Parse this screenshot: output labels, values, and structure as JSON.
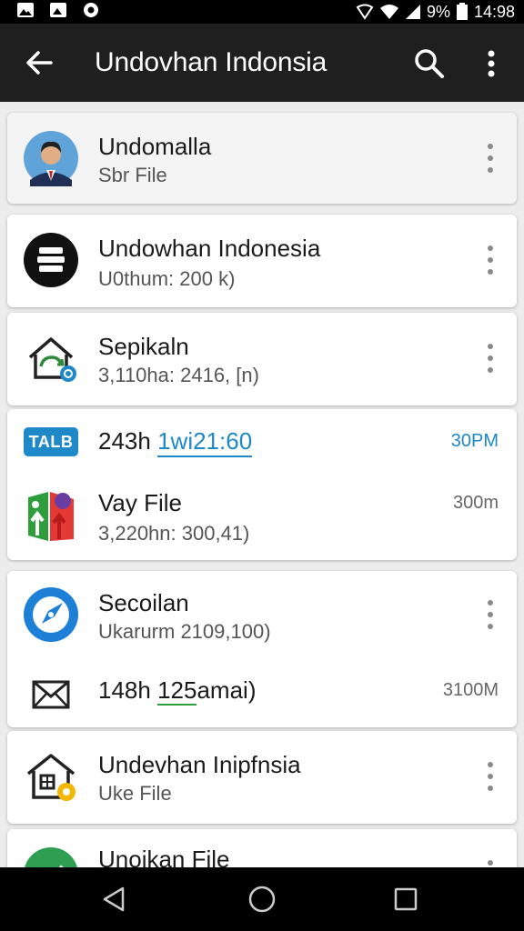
{
  "status_bar": {
    "battery": "9%",
    "time": "14:98",
    "icons": [
      "image-icon",
      "photo-icon",
      "settings-icon",
      "vpn-icon",
      "wifi-icon",
      "signal-icon",
      "battery-icon"
    ]
  },
  "app_bar": {
    "title": "Undovhan Indonsia",
    "icons": [
      "back-arrow-icon",
      "search-icon",
      "more-vert-icon"
    ]
  },
  "items": [
    {
      "icon": "avatar",
      "title": "Undomalla",
      "subtitle": "Sbr File"
    },
    {
      "icon": "archive-icon",
      "title": "Undowhan Indonesia",
      "subtitle": "U0thum: 200 k)"
    },
    {
      "icon": "home-sync-icon",
      "title": "Sepikaln",
      "subtitle": "3,110ha: 2416, [n)"
    },
    {
      "badge": "TALB",
      "title_prefix": "243h",
      "title_link": "1wi21:60",
      "time": "30PM",
      "sub_icon": "colorful-app-icon",
      "sub_title": "Vay File",
      "sub_subtitle": "3,220hn: 300,41)",
      "sub_time": "300m"
    },
    {
      "icon": "compass-icon",
      "title": "Secoilan",
      "subtitle": "Ukarurm 2109,100)",
      "sub_icon": "mail-icon",
      "sub_title_prefix": "148h ",
      "sub_title_hl": "125",
      "sub_title_rest": "amai)",
      "sub_time": "3100M"
    },
    {
      "icon": "home-badge-icon",
      "title": "Undevhan Inipfnsia",
      "subtitle": "Uke File"
    },
    {
      "icon": "green-app-icon",
      "title": "Unoikan File"
    }
  ],
  "nav_bar": {
    "icons": [
      "back-triangle-icon",
      "home-circle-icon",
      "recents-square-icon"
    ]
  },
  "colors": {
    "app_bar": "#1f1f1f",
    "accent_blue": "#1e88c9",
    "background": "#ececec"
  }
}
